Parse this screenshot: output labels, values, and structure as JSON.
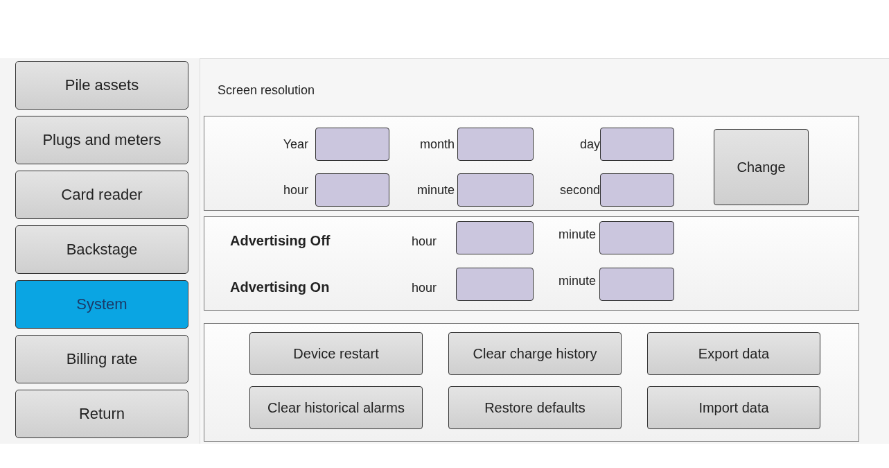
{
  "sidebar": {
    "items": [
      {
        "label": "Pile assets",
        "selected": false
      },
      {
        "label": "Plugs and meters",
        "selected": false
      },
      {
        "label": "Card reader",
        "selected": false
      },
      {
        "label": "Backstage",
        "selected": false
      },
      {
        "label": "System",
        "selected": true
      },
      {
        "label": "Billing rate",
        "selected": false
      },
      {
        "label": "Return",
        "selected": false
      }
    ]
  },
  "panel": {
    "title": "Screen resolution",
    "datetime": {
      "fields": [
        {
          "label": "Year"
        },
        {
          "label": "month"
        },
        {
          "label": "day"
        },
        {
          "label": "hour"
        },
        {
          "label": "minute"
        },
        {
          "label": "second"
        }
      ],
      "button": "Change"
    },
    "advertising": [
      {
        "label": "Advertising Off",
        "fields": [
          {
            "label": "hour"
          },
          {
            "label": "minute"
          }
        ]
      },
      {
        "label": "Advertising On",
        "fields": [
          {
            "label": "hour"
          },
          {
            "label": "minute"
          }
        ]
      }
    ],
    "actions": [
      "Device restart",
      "Clear charge history",
      "Export data",
      "Clear historical alarms",
      "Restore defaults",
      "Import data"
    ]
  }
}
